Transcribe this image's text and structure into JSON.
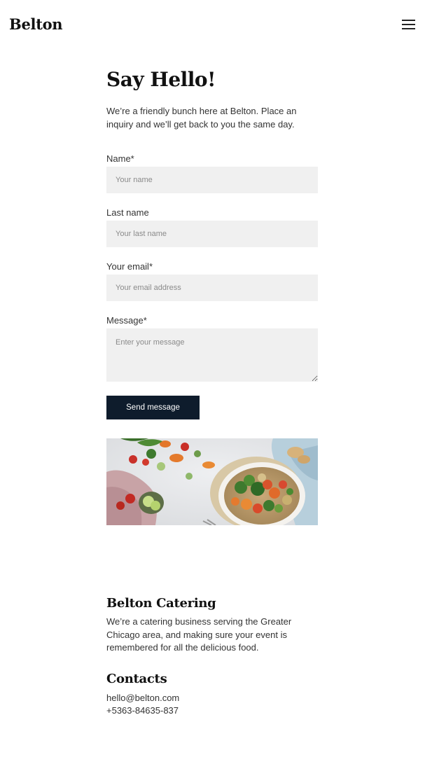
{
  "header": {
    "logo": "Belton",
    "menu_icon": "hamburger-menu-icon"
  },
  "main": {
    "title": "Say Hello!",
    "intro": "We’re a friendly bunch here at Belton. Place an inquiry and we’ll get back to you the same day."
  },
  "form": {
    "name": {
      "label": "Name*",
      "placeholder": "Your name",
      "value": ""
    },
    "last_name": {
      "label": "Last name",
      "placeholder": "Your last name",
      "value": ""
    },
    "email": {
      "label": "Your email*",
      "placeholder": "Your email address",
      "value": ""
    },
    "message": {
      "label": "Message*",
      "placeholder": "Enter your message",
      "value": ""
    },
    "submit_label": "Send message"
  },
  "colors": {
    "button_bg": "#0e1c2c",
    "input_bg": "#f0f0f0",
    "text": "#333333"
  },
  "footer": {
    "company_title": "Belton Catering",
    "company_text": "We’re a catering business serving the Greater Chicago area, and making sure your event is remembered for all the delicious food.",
    "contacts_title": "Contacts",
    "email": "hello@belton.com",
    "phone": "+5363-84635-837"
  }
}
